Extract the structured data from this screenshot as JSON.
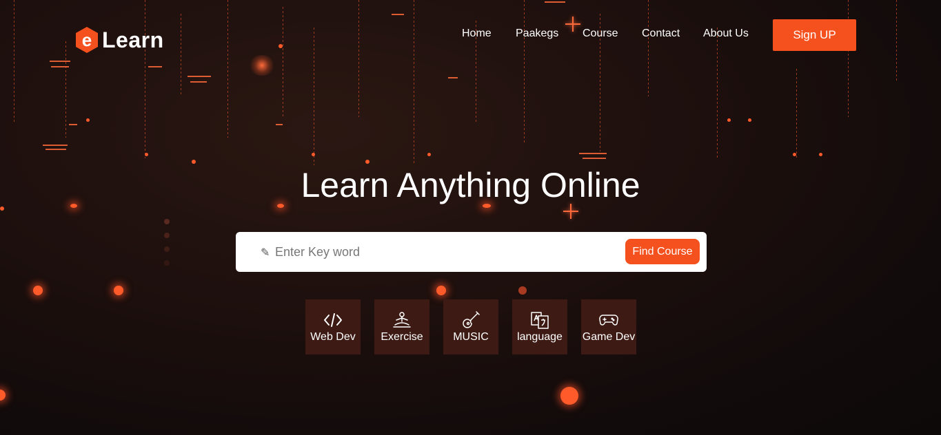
{
  "brand": {
    "logo_letter": "e",
    "name": "Learn",
    "accent": "#f4511e"
  },
  "nav": {
    "items": [
      {
        "label": "Home"
      },
      {
        "label": "Paakegs"
      },
      {
        "label": "Course"
      },
      {
        "label": "Contact"
      },
      {
        "label": "About Us"
      }
    ],
    "signup_label": "Sign UP"
  },
  "hero": {
    "title": "Learn Anything Online"
  },
  "search": {
    "icon": "pencil-icon",
    "placeholder": "Enter Key word",
    "button_label": "Find Course"
  },
  "categories": [
    {
      "label": "Web Dev",
      "icon": "code-icon"
    },
    {
      "label": "Exercise",
      "icon": "meditation-icon"
    },
    {
      "label": "MUSIC",
      "icon": "guitar-icon"
    },
    {
      "label": "language",
      "icon": "translate-icon"
    },
    {
      "label": "Game Dev",
      "icon": "gamepad-icon"
    }
  ],
  "colors": {
    "background": "#1c0f0d",
    "accent": "#f4511e",
    "category_tile": "#3d1b14",
    "text": "#ffffff"
  }
}
